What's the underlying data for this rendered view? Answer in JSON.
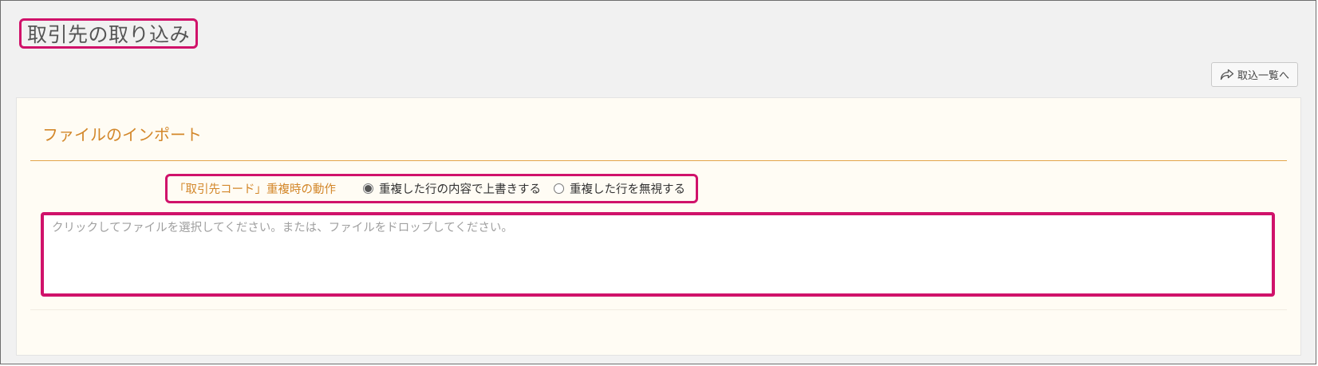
{
  "page": {
    "title": "取引先の取り込み"
  },
  "toolbar": {
    "back_label": "取込一覧へ",
    "back_icon": "share-forward-icon"
  },
  "import_panel": {
    "section_title": "ファイルのインポート",
    "duplicate_option": {
      "label": "「取引先コード」重複時の動作",
      "options": [
        {
          "label": "重複した行の内容で上書きする",
          "selected": true
        },
        {
          "label": "重複した行を無視する",
          "selected": false
        }
      ]
    },
    "drop_zone": {
      "placeholder": "クリックしてファイルを選択してください。または、ファイルをドロップしてください。"
    }
  },
  "colors": {
    "highlight": "#d0126a",
    "accent": "#d3872a",
    "background": "#f1f1f1",
    "panel": "#fffcf4"
  }
}
